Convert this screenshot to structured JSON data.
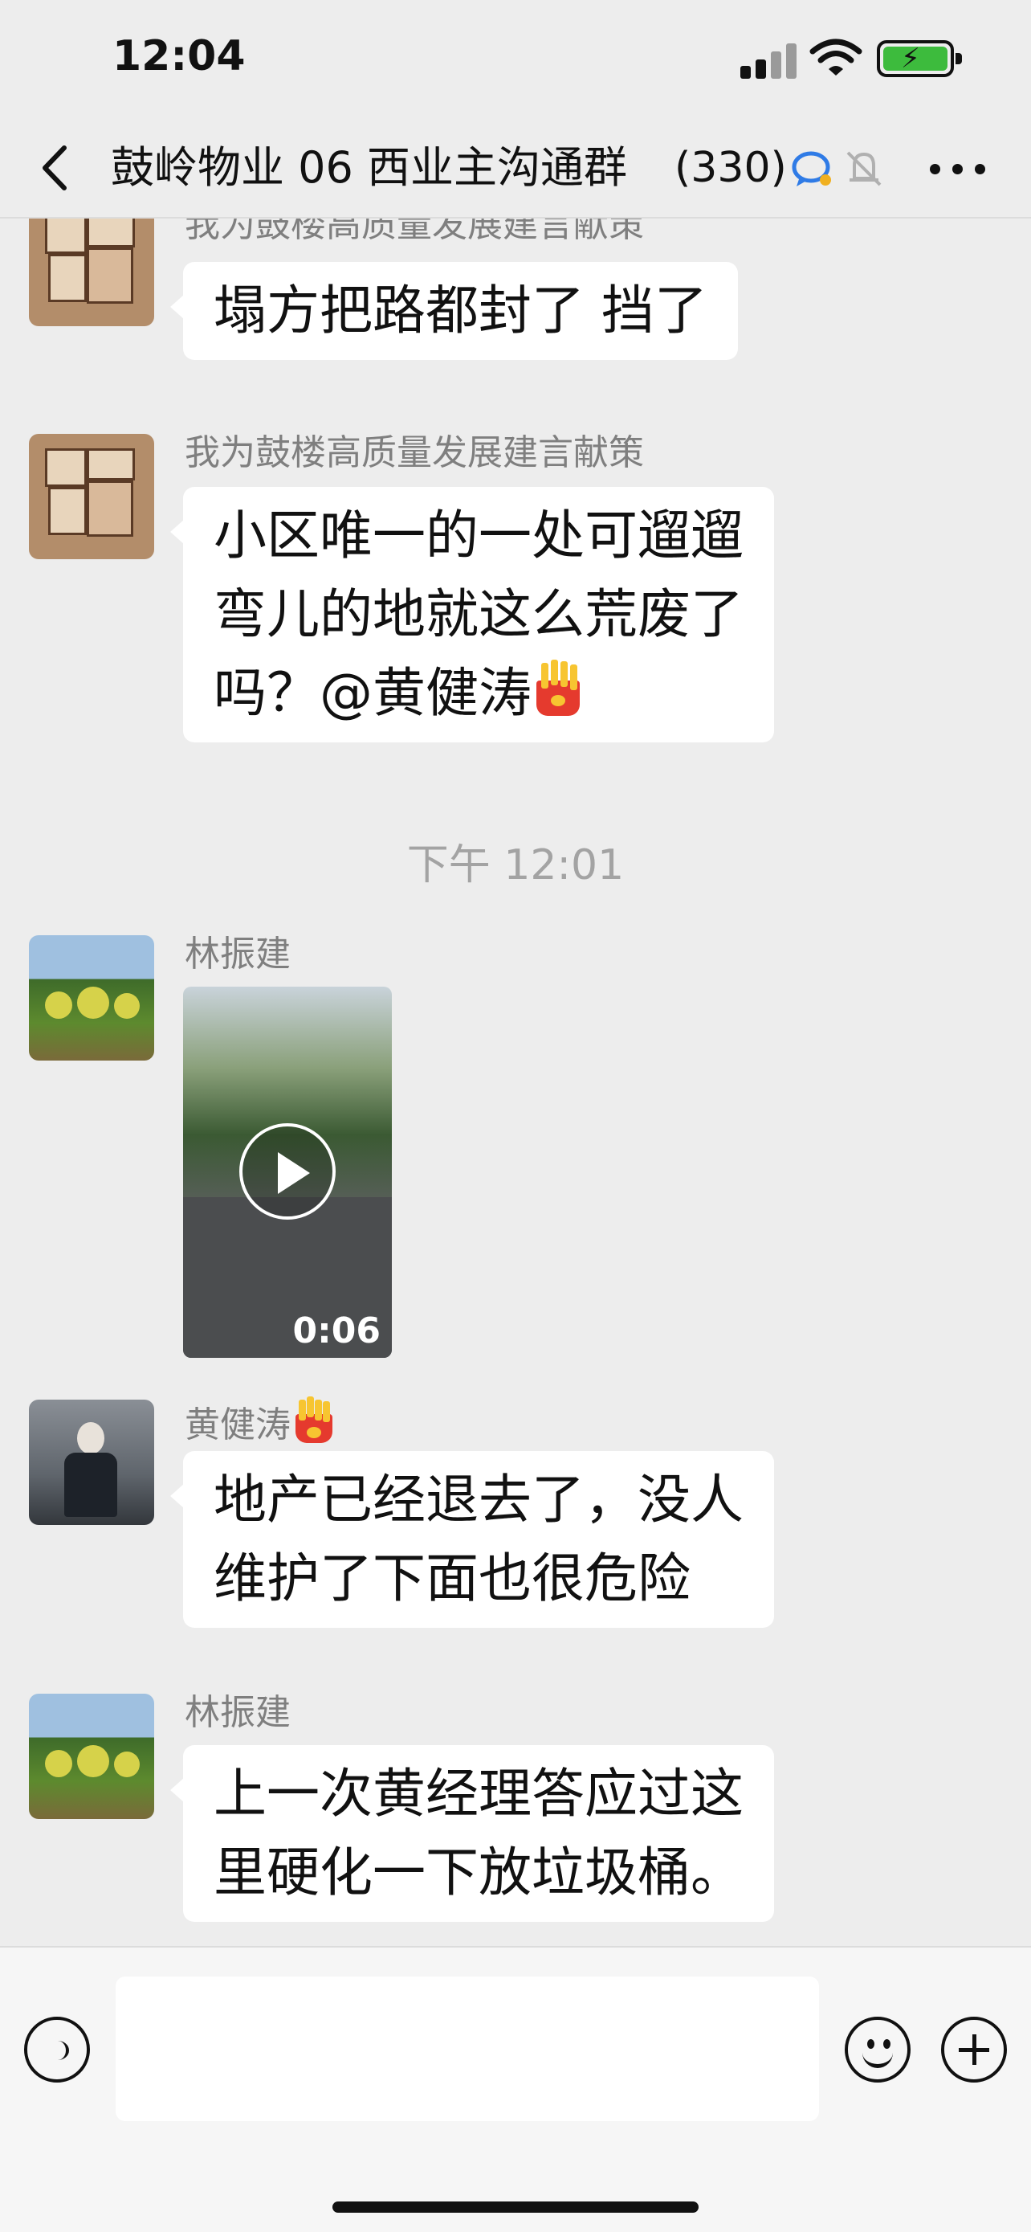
{
  "status_bar": {
    "time": "12:04"
  },
  "nav": {
    "title": "鼓岭物业 06 西业主沟通群",
    "member_count": "(330)"
  },
  "messages": [
    {
      "sender": "我为鼓楼高质量发展建言献策",
      "lines": [
        "塌方把路都封了 挡了"
      ]
    },
    {
      "sender": "我为鼓楼高质量发展建言献策",
      "lines": [
        "小区唯一的一处可遛遛",
        "弯儿的地就这么荒废了",
        "吗？@黄健涛"
      ]
    },
    {
      "timestamp": "下午 12:01"
    },
    {
      "sender": "林振建",
      "video_duration": "0:06"
    },
    {
      "sender": "黄健涛",
      "lines": [
        "地产已经退去了，没人",
        "维护了下面也很危险"
      ]
    },
    {
      "sender": "林振建",
      "lines": [
        "上一次黄经理答应过这",
        "里硬化一下放垃圾桶。"
      ]
    }
  ],
  "input_bar": {
    "placeholder": ""
  },
  "icons": {
    "back": "back-chevron-icon",
    "chat": "chat-bubble-icon",
    "mute": "bell-muted-icon",
    "more": "more-dots-icon",
    "voice": "voice-icon",
    "emoji": "smiley-icon",
    "plus": "plus-icon",
    "fries": "french-fries-emoji"
  },
  "colors": {
    "background": "#ededed",
    "bubble": "#ffffff",
    "sender_text": "#7f7f7f",
    "timestamp_text": "#a3a3a3",
    "battery": "#3dbb3d"
  }
}
